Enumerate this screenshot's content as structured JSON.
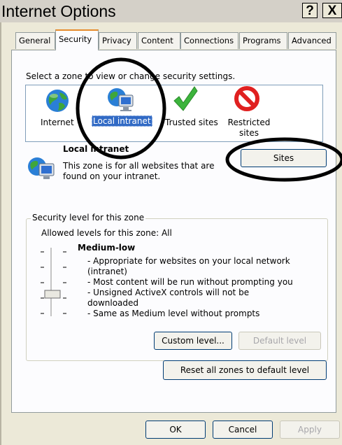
{
  "window": {
    "title": "Internet Options",
    "help_button": "?",
    "close_button": "X"
  },
  "tabs": [
    "General",
    "Security",
    "Privacy",
    "Content",
    "Connections",
    "Programs",
    "Advanced"
  ],
  "active_tab": "Security",
  "zones": {
    "prompt": "Select a zone to view or change security settings.",
    "items": [
      {
        "label": "Internet",
        "icon": "globe-icon"
      },
      {
        "label": "Local intranet",
        "icon": "intranet-icon",
        "selected": true
      },
      {
        "label": "Trusted sites",
        "icon": "checkmark-icon"
      },
      {
        "label": "Restricted sites",
        "icon": "restricted-icon"
      }
    ]
  },
  "zone_info": {
    "title": "Local intranet",
    "description": "This zone is for all websites that are found on your intranet.",
    "sites_button": "Sites"
  },
  "security_level": {
    "group_title": "Security level for this zone",
    "allowed": "Allowed levels for this zone: All",
    "level_name": "Medium-low",
    "details": [
      "- Appropriate for websites on your local network (intranet)",
      "- Most content will be run without prompting you",
      "- Unsigned ActiveX controls will not be downloaded",
      "- Same as Medium level without prompts"
    ],
    "custom_button": "Custom level...",
    "default_button": "Default level",
    "reset_button": "Reset all zones to default level"
  },
  "footer": {
    "ok": "OK",
    "cancel": "Cancel",
    "apply": "Apply"
  },
  "colors": {
    "selection": "#316ac5",
    "tab_accent": "#e68b2c",
    "annotation": "#000000"
  }
}
